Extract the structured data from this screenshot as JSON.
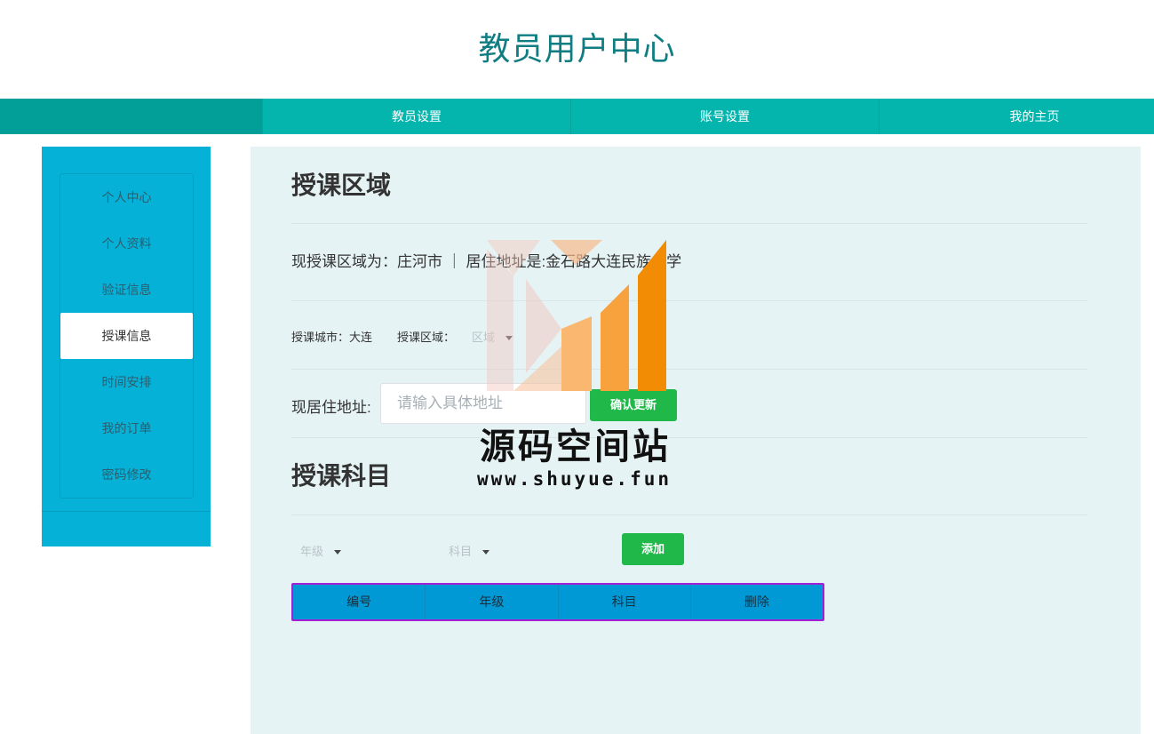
{
  "header": {
    "title": "教员用户中心"
  },
  "topnav": {
    "items": [
      "教员设置",
      "账号设置",
      "我的主页"
    ]
  },
  "sidebar": {
    "items": [
      {
        "label": "个人中心"
      },
      {
        "label": "个人资料"
      },
      {
        "label": "验证信息"
      },
      {
        "label": "授课信息",
        "active": true
      },
      {
        "label": "时间安排"
      },
      {
        "label": "我的订单"
      },
      {
        "label": "密码修改"
      }
    ]
  },
  "area": {
    "heading": "授课区域",
    "current_text": "现授课区域为：庄河市 ｜ 居住地址是:金石路大连民族大学",
    "city_label": "授课城市：大连",
    "district_label": "授课区域：",
    "district_select": "区域",
    "address_label": "现居住地址:",
    "address_placeholder": "请输入具体地址",
    "address_value": "",
    "confirm_button": "确认更新"
  },
  "subjects": {
    "heading": "授课科目",
    "grade_select": "年级",
    "subject_select": "科目",
    "add_button": "添加",
    "columns": [
      "编号",
      "年级",
      "科目",
      "删除"
    ]
  },
  "watermark": {
    "name": "源码空间站",
    "url": "www.shuyue.fun"
  },
  "colors": {
    "title": "#0f7d82",
    "nav": "#04b5ad",
    "sidebar": "#06b1d8",
    "main_bg": "#e6f3f4",
    "button": "#21b84a",
    "table_header": "#0099d6",
    "table_border": "#a31fd6"
  }
}
